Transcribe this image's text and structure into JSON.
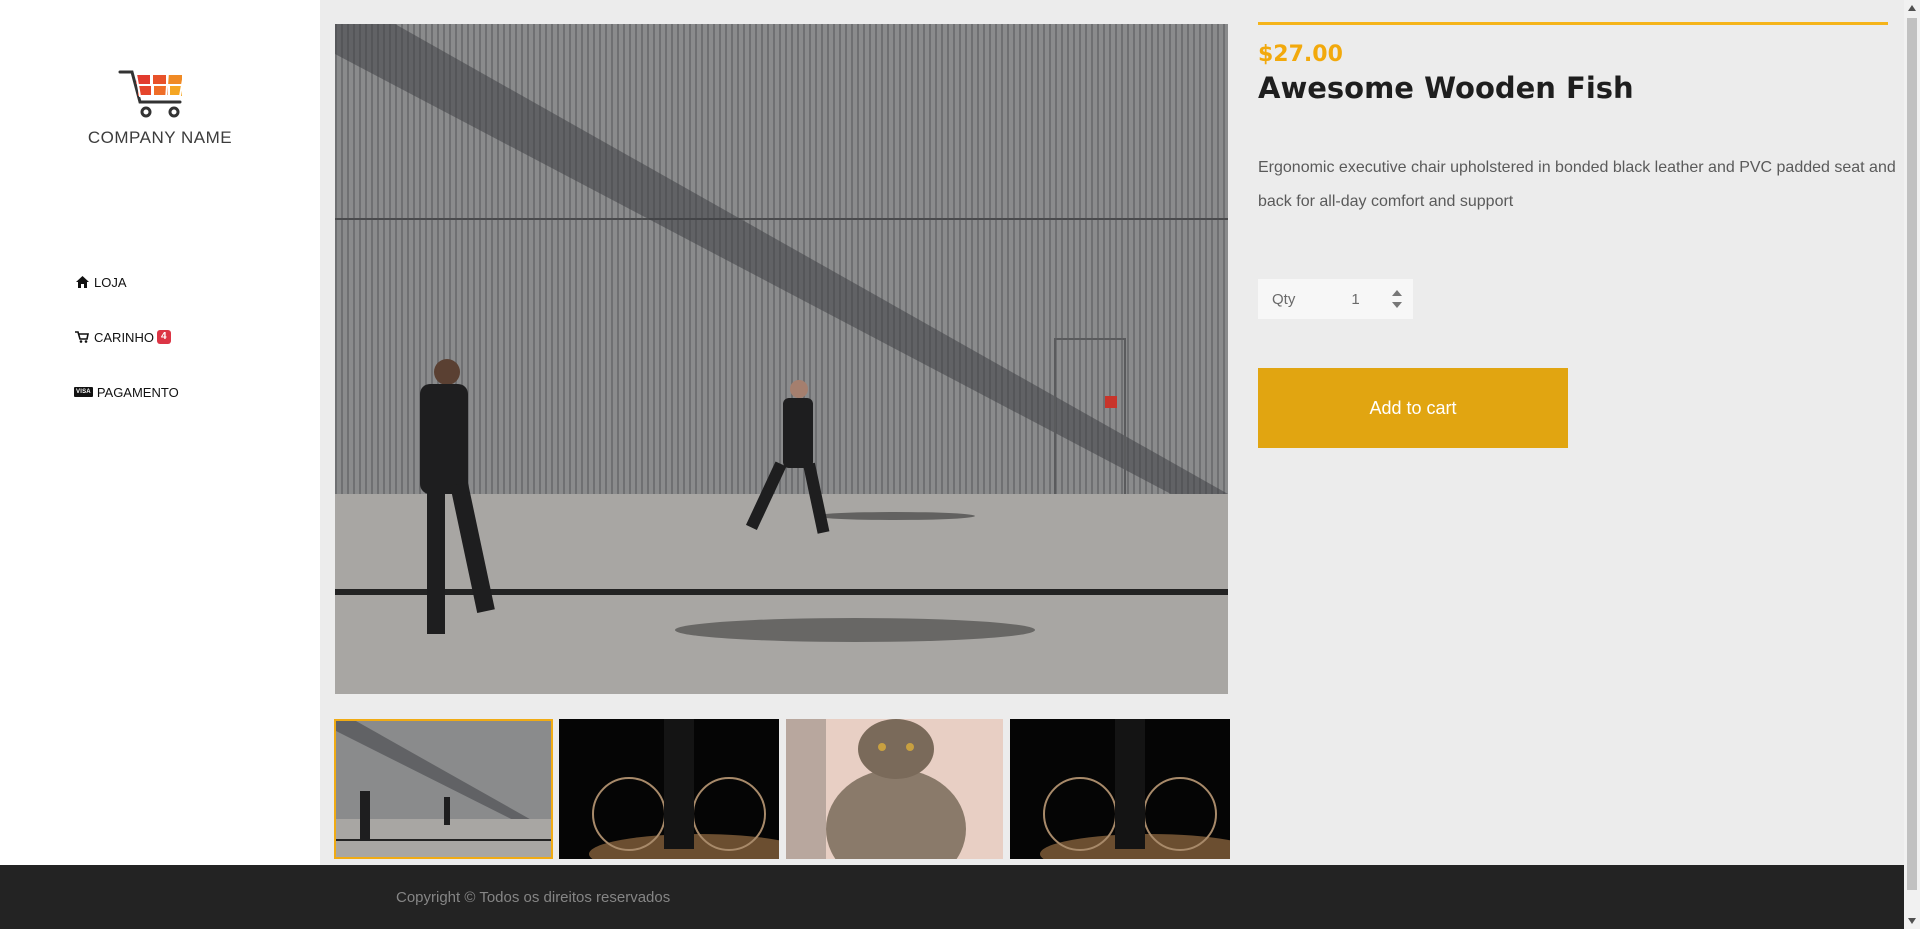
{
  "brand": {
    "name": "COMPANY NAME"
  },
  "nav": [
    {
      "label": "LOJA",
      "icon": "home-icon"
    },
    {
      "label": "CARINHO",
      "icon": "cart-icon",
      "badge": "4"
    },
    {
      "label": "PAGAMENTO",
      "icon": "visa-card-icon",
      "icon_text": "VISA"
    }
  ],
  "product": {
    "price": "$27.00",
    "name": "Awesome Wooden Fish",
    "description": "Ergonomic executive chair upholstered in bonded black leather and PVC padded seat and back for all-day comfort and support",
    "qty_label": "Qty",
    "qty_value": "1",
    "add_to_cart_label": "Add to cart"
  },
  "gallery": {
    "main_image": "people-walking-by-corrugated-wall",
    "thumbnails": [
      {
        "image": "people-walking-by-corrugated-wall",
        "active": true
      },
      {
        "image": "person-with-bicycle-dark",
        "active": false
      },
      {
        "image": "tabby-cat",
        "active": false
      },
      {
        "image": "person-with-bicycle-dark",
        "active": false
      }
    ]
  },
  "footer": {
    "copyright": "Copyright © Todos os direitos reservados"
  },
  "colors": {
    "accent": "#e1a511",
    "price": "#f2a90c",
    "badge": "#dc3545",
    "footer_bg": "#232323"
  }
}
